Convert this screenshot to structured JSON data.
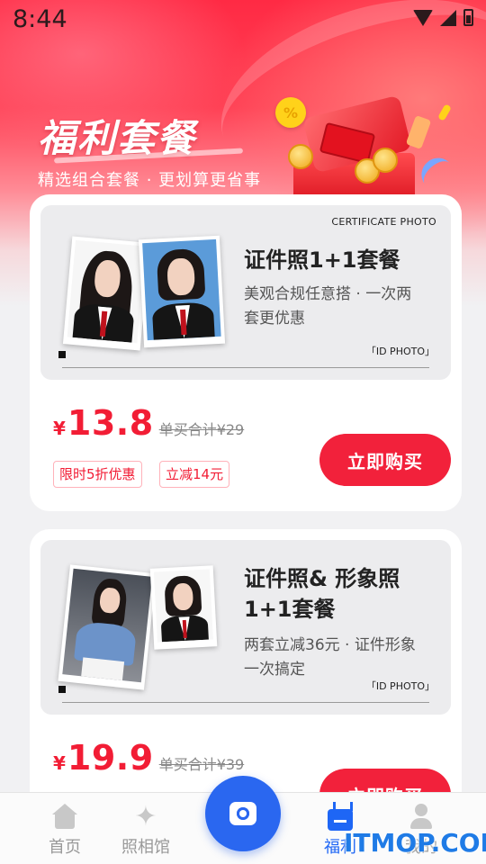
{
  "status_bar": {
    "time": "8:44"
  },
  "hero": {
    "title": "福利套餐",
    "subtitle": "精选组合套餐 · 更划算更省事",
    "badge_symbol": "%"
  },
  "packages": [
    {
      "corner_label": "CERTIFICATE PHOTO",
      "title": "证件照1+1套餐",
      "description": "美观合规任意搭 · 一次两套更优惠",
      "id_label": "「ID PHOTO」",
      "currency": "¥",
      "price": "13.8",
      "original_price": "单买合计¥29",
      "tags": [
        "限时5折优惠",
        "立减14元"
      ],
      "buy_label": "立即购买"
    },
    {
      "title_line1": "证件照& 形象照",
      "title_line2": "1+1套餐",
      "description": "两套立减36元 · 证件形象一次搞定",
      "id_label": "「ID PHOTO」",
      "currency": "¥",
      "price": "19.9",
      "original_price": "单买合计¥39",
      "buy_label": "立即购买"
    }
  ],
  "bottom_nav": {
    "items": [
      {
        "label": "首页",
        "icon": "home-icon"
      },
      {
        "label": "照相馆",
        "icon": "sparkle-icon"
      },
      {
        "label": "福利",
        "icon": "welfare-icon",
        "active": true
      },
      {
        "label": "我的",
        "icon": "user-icon"
      }
    ],
    "fab_icon": "camera-icon"
  },
  "watermark": "ITMOP.COM",
  "colors": {
    "accent_red": "#f2213b",
    "price_red": "#f21d35",
    "nav_active_blue": "#1e66f5",
    "fab_blue": "#2a67f0"
  }
}
